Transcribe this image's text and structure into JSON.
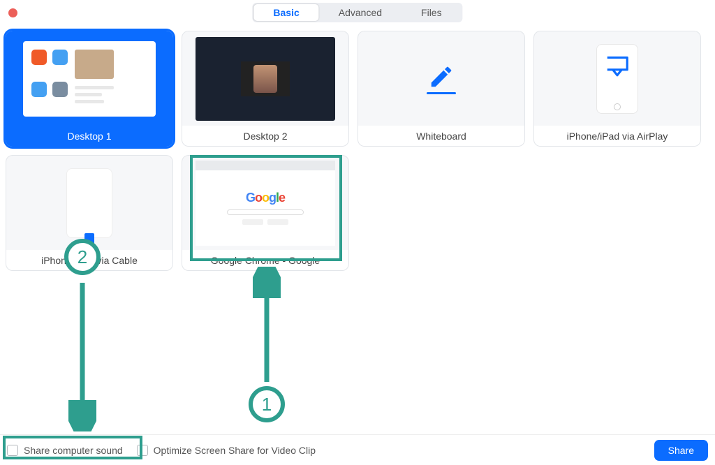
{
  "tabs": {
    "basic": "Basic",
    "advanced": "Advanced",
    "files": "Files"
  },
  "tiles": {
    "desktop1": "Desktop 1",
    "desktop2": "Desktop 2",
    "whiteboard": "Whiteboard",
    "airplay": "iPhone/iPad via AirPlay",
    "cable": "iPhone/iPad via Cable",
    "chrome": "Google Chrome - Google"
  },
  "options": {
    "share_sound": "Share computer sound",
    "optimize_video": "Optimize Screen Share for Video Clip"
  },
  "buttons": {
    "share": "Share"
  },
  "annotations": {
    "one": "1",
    "two": "2"
  },
  "colors": {
    "accent_blue": "#0b6cff",
    "annotation_teal": "#2e9e8e"
  }
}
